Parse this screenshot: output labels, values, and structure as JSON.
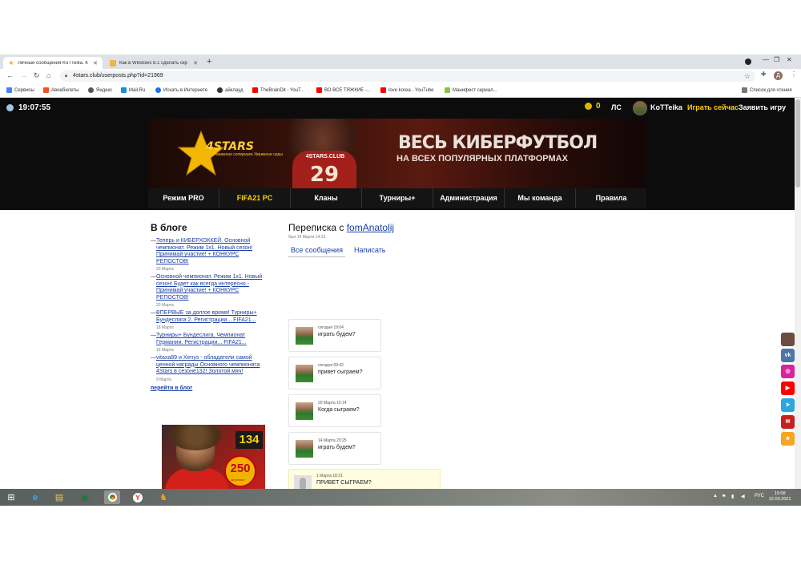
{
  "browser": {
    "tabs": [
      {
        "title": "Личные сообщения KoTTeika. К",
        "active": true
      },
      {
        "title": "Как в Windows 8.1 сделать скр",
        "active": false
      }
    ],
    "new_tab": "+",
    "url": "4stars.club/userposts.php?id=21969",
    "bookmarks": [
      {
        "label": "Сервисы",
        "color": "#4285f4"
      },
      {
        "label": "Авиабилеты",
        "color": "#f4511e"
      },
      {
        "label": "Яндекс",
        "color": "#555555"
      },
      {
        "label": "Mail.Ru",
        "color": "#168de2"
      },
      {
        "label": "Искать в Интернете",
        "color": "#1a73e8"
      },
      {
        "label": "айклауд",
        "color": "#333333"
      },
      {
        "label": "TheBrainDit - YouT...",
        "color": "#ff0000"
      },
      {
        "label": "ВО ВСЕ ТЯЖКИЕ -...",
        "color": "#ff0000"
      },
      {
        "label": "love korea - YouTube",
        "color": "#ff0000"
      },
      {
        "label": "Манифест сериал...",
        "color": "#8bc34a"
      }
    ],
    "reading_list": "Список для чтения",
    "profile_letter": "Д"
  },
  "site": {
    "clock": "19:07:55",
    "coins": "0",
    "nav": {
      "pm": "ЛС",
      "username": "KoTTeika",
      "play_now": "Играть сейчас",
      "request_game": "Заявить игру"
    },
    "banner": {
      "logo": "4STARS",
      "logo_sub": "Уважение соперника Уважение игры",
      "jersey_label": "4STARS.CLUB",
      "jersey_number": "29",
      "headline": "ВЕСЬ КИБЕРФУТБОЛ",
      "subheadline": "НА ВСЕХ ПОПУЛЯРНЫХ ПЛАТФОРМАХ"
    },
    "menu": [
      {
        "label": "Режим PRO",
        "highlight": false
      },
      {
        "label": "FIFA21 PC",
        "highlight": true
      },
      {
        "label": "Кланы",
        "highlight": false
      },
      {
        "label": "Турниры+",
        "highlight": false
      },
      {
        "label": "Администрация",
        "highlight": false
      },
      {
        "label": "Мы команда",
        "highlight": false
      },
      {
        "label": "Правила",
        "highlight": false
      }
    ]
  },
  "blog": {
    "title": "В блоге",
    "posts": [
      {
        "title": "Теперь и КИБЕРХОККЕЙ. Основной чемпионат. Режим 1х1. Новый сезон! Принимай участие! + КОНКУРС РЕПОСТОВ!",
        "date": "20 Марта"
      },
      {
        "title": "Основной чемпионат. Режим 1х1. Новый сезон! Будет как всегда интересно - Принимай участие! + КОНКУРС РЕПОСТОВ!",
        "date": "20 Марта"
      },
      {
        "title": "ВПЕРВЫЕ за долгое время! Турниры+ Бундеслига 2. Регистрации... FIFA21...",
        "date": "18 Марта"
      },
      {
        "title": "Турниры+ Бундеслига. Чемпионат Германии. Регистрации... FIFA21...",
        "date": "15 Марта"
      },
      {
        "title": "vitaxa89 и Xenys - обладатели самой ценной награды Основного чемпионата 4Stars в сезоне132! Золотой мяч!",
        "date": "9 Марта"
      }
    ],
    "go_to_blog": "перейти в блог",
    "promo": {
      "number": "134",
      "badge": "250",
      "badge_sub": "за репост"
    }
  },
  "conversation": {
    "title_prefix": "Переписка с",
    "partner": "fomAnatolij",
    "last_seen": "был 14 Марта 14:13",
    "tabs": [
      "Все сообщения",
      "Написать"
    ],
    "messages": [
      {
        "time": "сегодня 19:04",
        "text": "играть будем?",
        "incoming": false
      },
      {
        "time": "сегодня 09:42",
        "text": "привет сыграем?",
        "incoming": false
      },
      {
        "time": "20 Марта 10:14",
        "text": "Когда сыграем?",
        "incoming": false
      },
      {
        "time": "14 Марта 20:25",
        "text": "играть будем?",
        "incoming": false
      },
      {
        "time": "1 Марта 18:21",
        "text": "ПРИВЕТ СЫГРАЕМ?",
        "incoming": true
      }
    ]
  },
  "social": [
    {
      "icon": "user-avatar-icon",
      "color": "#6d4c41",
      "label": ""
    },
    {
      "icon": "vk-icon",
      "color": "#4a76a8",
      "label": "vk"
    },
    {
      "icon": "instagram-icon",
      "color": "#d6249f",
      "label": "◎"
    },
    {
      "icon": "youtube-icon",
      "color": "#ff0000",
      "label": "▶"
    },
    {
      "icon": "telegram-icon",
      "color": "#2ca5e0",
      "label": "➤"
    },
    {
      "icon": "gmail-icon",
      "color": "#c5221f",
      "label": "✉"
    },
    {
      "icon": "star-icon",
      "color": "#f5a623",
      "label": "★"
    }
  ],
  "taskbar": {
    "language": "РУС",
    "time": "19:08",
    "date": "22.03.2021"
  }
}
